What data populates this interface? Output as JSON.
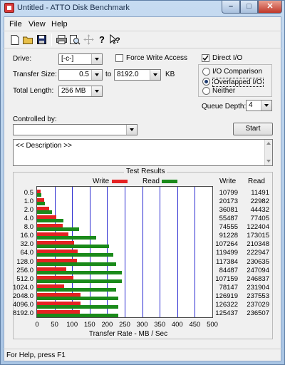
{
  "window": {
    "title": "Untitled - ATTO Disk Benchmark"
  },
  "menu": [
    "File",
    "View",
    "Help"
  ],
  "toolbar_icons": [
    "new-document-icon",
    "open-folder-icon",
    "save-icon",
    "print-icon",
    "print-preview-icon",
    "move-icon",
    "help-icon",
    "context-help-icon"
  ],
  "settings": {
    "drive_label": "Drive:",
    "drive_value": "[-c-]",
    "transfer_size_label": "Transfer Size:",
    "transfer_from": "0.5",
    "to_label": "to",
    "transfer_to": "8192.0",
    "kb_label": "KB",
    "total_length_label": "Total Length:",
    "total_length_value": "256 MB",
    "force_write_label": "Force Write Access",
    "direct_io_label": "Direct I/O",
    "io_comparison_label": "I/O Comparison",
    "overlapped_io_label": "Overlapped I/O",
    "neither_label": "Neither",
    "queue_depth_label": "Queue Depth:",
    "queue_depth_value": "4",
    "controlled_by_label": "Controlled by:",
    "controlled_by_value": "",
    "start_label": "Start",
    "description": "<< Description >>"
  },
  "results": {
    "group_label": "Test Results",
    "write_legend": "Write",
    "read_legend": "Read",
    "write_col": "Write",
    "read_col": "Read",
    "xlabel": "Transfer Rate - MB / Sec"
  },
  "chart_data": {
    "type": "bar",
    "orientation": "horizontal",
    "categories": [
      "0.5",
      "1.0",
      "2.0",
      "4.0",
      "8.0",
      "16.0",
      "32.0",
      "64.0",
      "128.0",
      "256.0",
      "512.0",
      "1024.0",
      "2048.0",
      "4096.0",
      "8192.0"
    ],
    "series": [
      {
        "name": "Write",
        "color": "#e52222",
        "values": [
          10799,
          20173,
          36081,
          55487,
          74555,
          91228,
          107264,
          119499,
          117384,
          84487,
          107159,
          78147,
          126919,
          126322,
          125437
        ]
      },
      {
        "name": "Read",
        "color": "#1a8a1a",
        "values": [
          11491,
          22982,
          44432,
          77405,
          122404,
          173015,
          210348,
          222947,
          230635,
          247094,
          246837,
          231904,
          237553,
          237029,
          236507
        ]
      }
    ],
    "xlabel": "Transfer Rate - MB / Sec",
    "xlim": [
      0,
      500
    ],
    "xticks": [
      "0",
      "50",
      "100",
      "150",
      "200",
      "250",
      "300",
      "350",
      "400",
      "450",
      "500"
    ]
  },
  "status": {
    "text": "For Help, press F1"
  }
}
